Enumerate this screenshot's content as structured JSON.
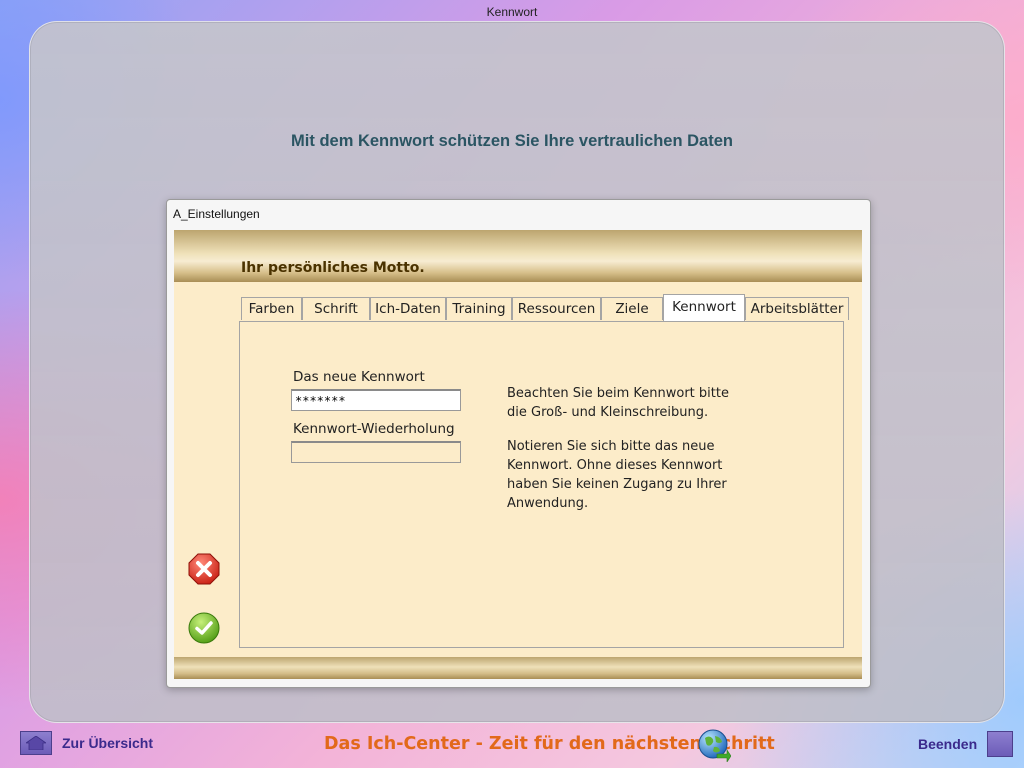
{
  "window_title": "Kennwort",
  "heading": "Mit dem Kennwort schützen Sie Ihre vertraulichen Daten",
  "dialog": {
    "title": "A_Einstellungen",
    "motto": "Ihr persönliches Motto.",
    "tabs": [
      "Farben",
      "Schrift",
      "Ich-Daten",
      "Training",
      "Ressourcen",
      "Ziele",
      "Kennwort",
      "Arbeitsblätter"
    ],
    "active_tab": "Kennwort",
    "form": {
      "new_password_label": "Das neue Kennwort",
      "new_password_value": "*******",
      "repeat_label": "Kennwort-Wiederholung",
      "repeat_value": "",
      "note_1": "Beachten Sie beim Kennwort bitte die Groß- und Kleinschreibung.",
      "note_2": "Notieren Sie sich bitte das neue Kennwort. Ohne dieses Kennwort haben Sie keinen Zugang zu Ihrer Anwendung."
    },
    "actions": {
      "cancel_icon": "cancel-x-icon",
      "confirm_icon": "confirm-check-icon"
    }
  },
  "footer": {
    "back_label": "Zur Übersicht",
    "title": "Das Ich-Center - Zeit für den nächsten Schritt",
    "quit_label": "Beenden"
  },
  "colors": {
    "heading": "#2b5563",
    "form_background": "#fcecc9",
    "footer_title": "#e2691a",
    "nav_label": "#3b2a8c"
  }
}
